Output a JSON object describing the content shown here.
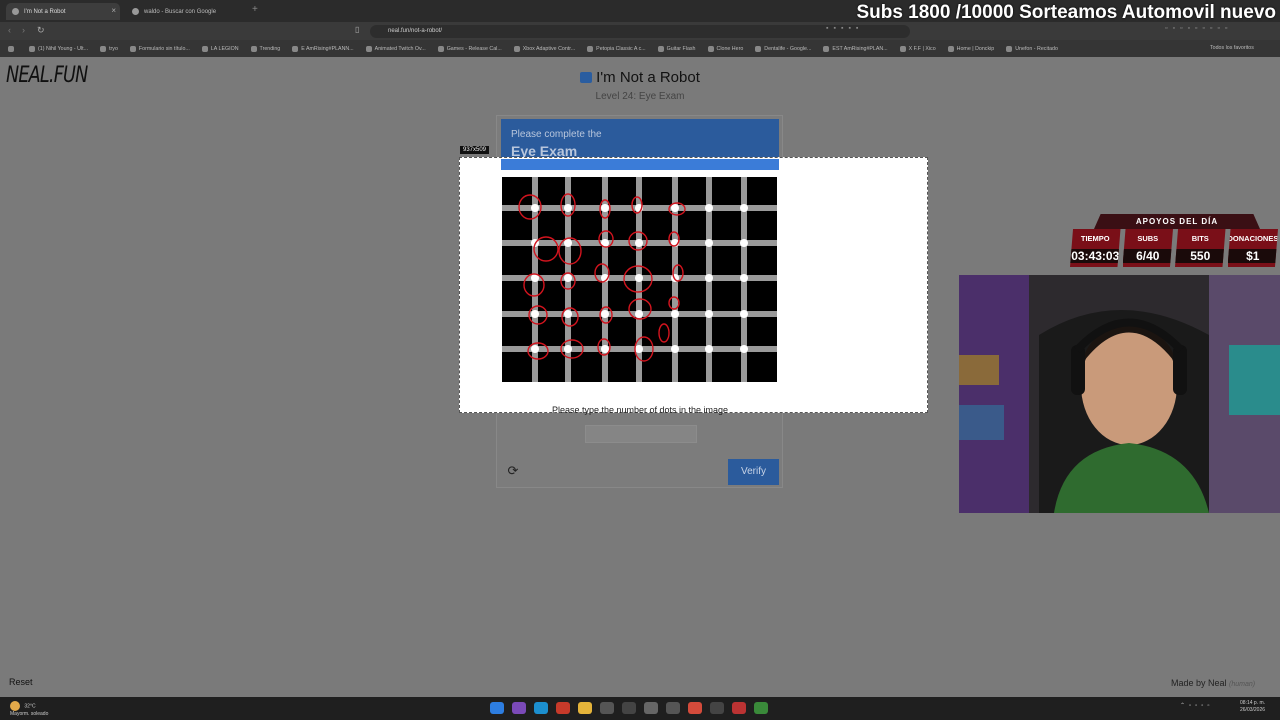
{
  "browser": {
    "tabs": [
      {
        "title": "I'm Not a Robot",
        "active": true
      },
      {
        "title": "waldo - Buscar con Google",
        "active": false
      }
    ],
    "url": "neal.fun/not-a-robot/",
    "bookmarks": [
      "(1) Nihil Young - Ult...",
      "tryo",
      "Formulario sin título...",
      "LA LEGION",
      "Trending",
      "E AmRising#PLANN...",
      "Animated Twitch Ov...",
      "Games - Release Cal...",
      "Xbox Adaptive Contr...",
      "Petopia Classic A c...",
      "Guitar Flash",
      "Clone Hero",
      "Dentalife - Google...",
      "EST AmRising#PLAN...",
      "X F.F | Xico",
      "Home | Donckip",
      "Unefon - Recitado"
    ],
    "all_favorites": "Todos los favoritos"
  },
  "stream": {
    "overlay_title": "Subs 1800 /10000 Sorteamos Automovil nuevo",
    "support_header": "APOYOS DEL DÍA",
    "stats": [
      {
        "label": "TIEMPO",
        "value": "03:43:03"
      },
      {
        "label": "SUBS",
        "value": "6/40"
      },
      {
        "label": "BITS",
        "value": "550"
      },
      {
        "label": "DONACIONES",
        "value": "$1"
      }
    ]
  },
  "page": {
    "logo": "NEAL.FUN",
    "title": "I'm Not a Robot",
    "level": "Level 24: Eye Exam",
    "captcha_line1": "Please complete the",
    "captcha_line2": "Eye Exam",
    "dimension_label": "937x509",
    "prompt": "Please type the number of dots in the image",
    "answer_value": "",
    "verify_label": "Verify",
    "reset_label": "Reset",
    "made_by": "Made by Neal",
    "made_by_human": "(human)"
  },
  "taskbar": {
    "weather_temp": "32°C",
    "weather_desc": "Mayorm. soleado",
    "time": "08:14 p. m.",
    "date": "26/03/2026"
  }
}
